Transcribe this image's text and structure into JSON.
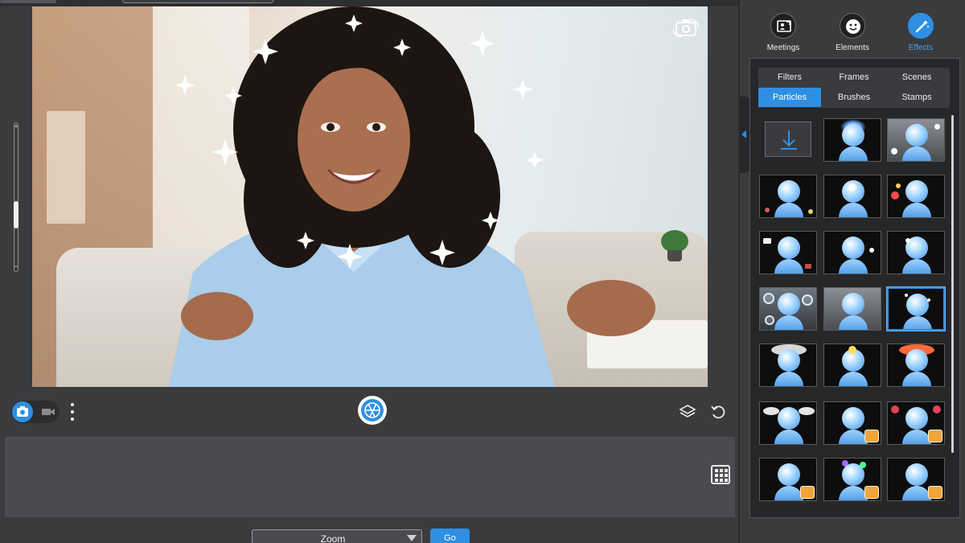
{
  "right_panel": {
    "main_tabs": [
      {
        "label": "Meetings",
        "icon": "meetings-icon",
        "active": false
      },
      {
        "label": "Elements",
        "icon": "smiley-icon",
        "active": false
      },
      {
        "label": "Effects",
        "icon": "magic-wand-icon",
        "active": true
      }
    ],
    "sub_tabs": [
      {
        "label": "Filters",
        "active": false
      },
      {
        "label": "Frames",
        "active": false
      },
      {
        "label": "Scenes",
        "active": false
      },
      {
        "label": "Particles",
        "active": true
      },
      {
        "label": "Brushes",
        "active": false
      },
      {
        "label": "Stamps",
        "active": false
      }
    ],
    "particle_count_visible": 21,
    "selected_particle_index": 9
  },
  "footer": {
    "zoom_select_value": "Zoom",
    "go_label": "Go"
  },
  "colors": {
    "accent": "#2e8fe3",
    "panel_bg": "#262729",
    "app_bg": "#3a3b3d"
  }
}
